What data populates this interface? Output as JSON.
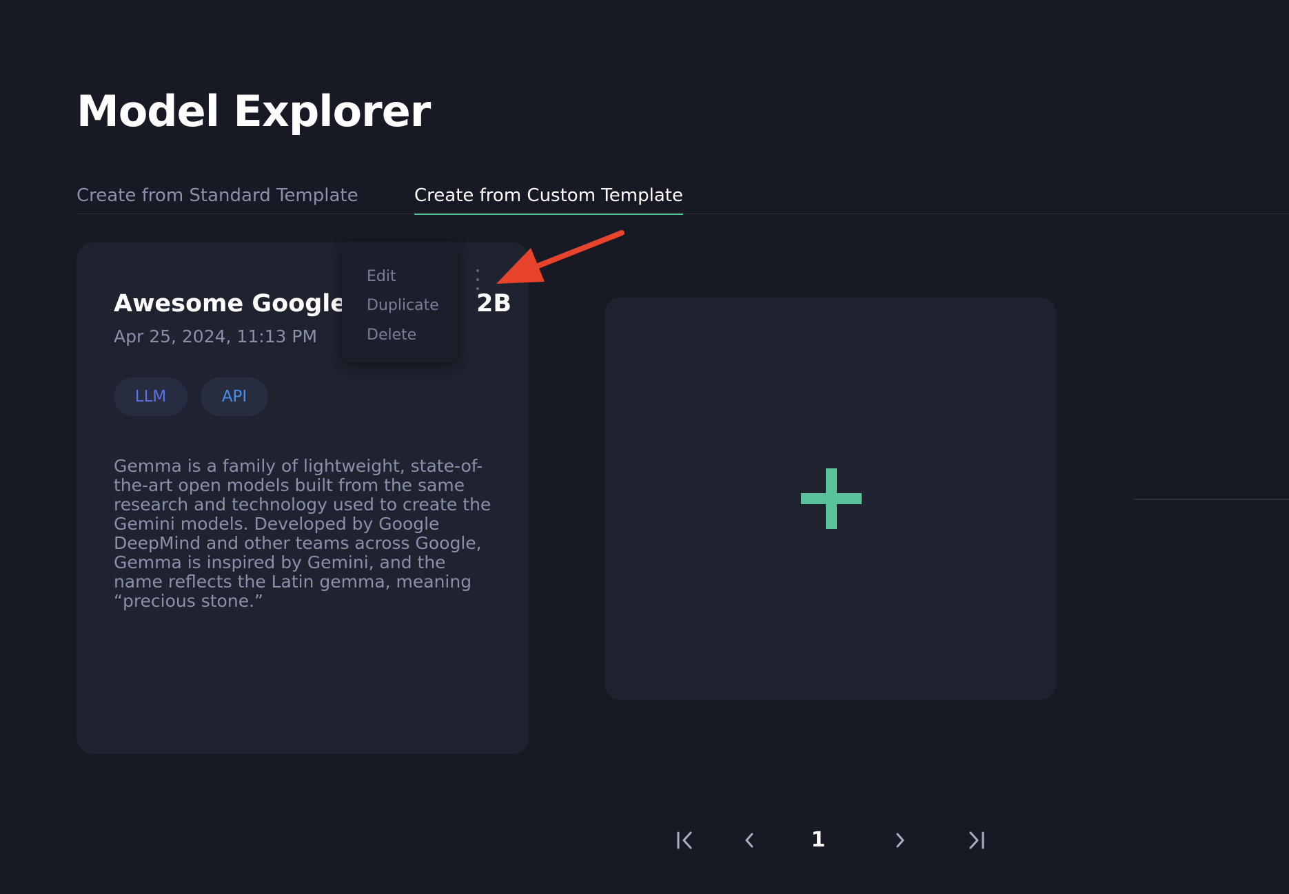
{
  "page": {
    "title": "Model Explorer"
  },
  "tabs": [
    {
      "label": "Create from Standard Template",
      "active": false
    },
    {
      "label": "Create from Custom Template",
      "active": true
    }
  ],
  "colors": {
    "background": "#171925",
    "card": "#1f222f",
    "accent": "#59c29a",
    "muted_text": "#8c90ab",
    "annotation_arrow": "#e8442d"
  },
  "model_card": {
    "title": "Awesome Google",
    "title_suffix": "2B",
    "date": "Apr 25, 2024, 11:13 PM",
    "tags": [
      "LLM",
      "API"
    ],
    "description": "Gemma is a family of lightweight, state-of-the-art open models built from the same research and technology used to create the Gemini models. Developed by Google DeepMind and other teams across Google, Gemma is inspired by Gemini, and the name reflects the Latin gemma, meaning “precious stone.”",
    "menu_icon": "more-vertical-icon"
  },
  "context_menu": {
    "items": [
      "Edit",
      "Duplicate",
      "Delete"
    ]
  },
  "add_card": {
    "icon": "plus-icon"
  },
  "pagination": {
    "current_page": "1",
    "icons": [
      "first-page-icon",
      "prev-page-icon",
      "next-page-icon",
      "last-page-icon"
    ]
  }
}
